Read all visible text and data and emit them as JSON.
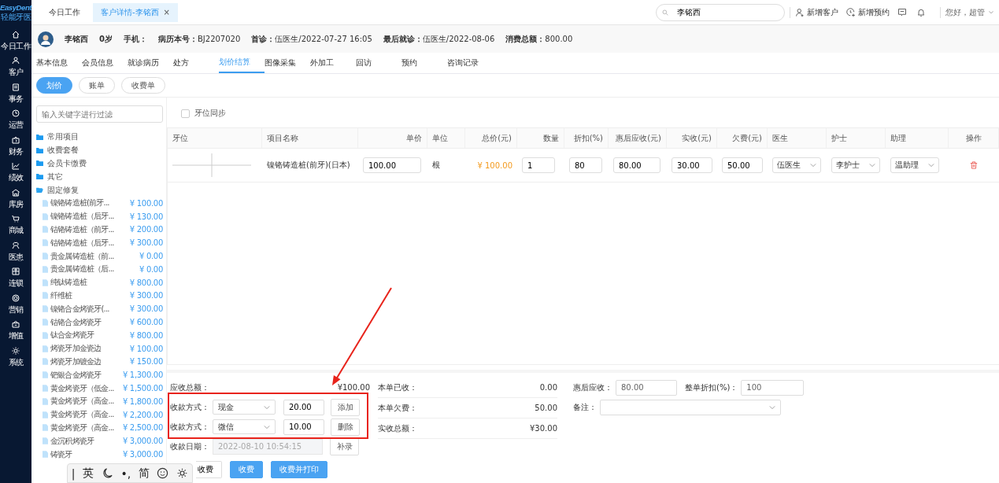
{
  "brand": {
    "name": "EasyDent",
    "subtitle": "轻能牙医"
  },
  "nav": [
    {
      "label": "今日工作"
    },
    {
      "label": "客户"
    },
    {
      "label": "事务"
    },
    {
      "label": "运营"
    },
    {
      "label": "财务"
    },
    {
      "label": "绩效"
    },
    {
      "label": "库房"
    },
    {
      "label": "商城"
    },
    {
      "label": "医患"
    },
    {
      "label": "连锁"
    },
    {
      "label": "营销"
    },
    {
      "label": "增值"
    },
    {
      "label": "系统"
    }
  ],
  "top_tabs": [
    {
      "label": "今日工作",
      "selected": false
    },
    {
      "label": "客户详情-李铭西",
      "selected": true,
      "close": "×"
    }
  ],
  "search": {
    "value": "李铭西"
  },
  "header_actions": [
    {
      "label": "新增客户",
      "kind": "customer"
    },
    {
      "label": "新增预约",
      "kind": "appointment"
    }
  ],
  "greeting": "您好，超管",
  "patient": {
    "name": "李铭西",
    "age": "0岁",
    "fields": [
      {
        "label": "手机："
      },
      {
        "label": "病历本号：",
        "value": "BJ2207020"
      },
      {
        "label": "首诊：",
        "value": "伍医生/2022-07-27 16:05"
      },
      {
        "label": "最后就诊：",
        "value": "伍医生/2022-08-06"
      },
      {
        "label": "消费总额：",
        "value": "800.00"
      }
    ]
  },
  "tabs": [
    {
      "label": "基本信息",
      "selected": false
    },
    {
      "label": "会员信息",
      "selected": false
    },
    {
      "label": "就诊病历",
      "selected": false
    },
    {
      "label": "处方",
      "selected": false
    },
    {
      "label": "划价结算",
      "selected": true
    },
    {
      "label": "图像采集",
      "selected": false
    },
    {
      "label": "外加工",
      "selected": false
    },
    {
      "label": "回访",
      "selected": false
    },
    {
      "label": "预约",
      "selected": false
    },
    {
      "label": "咨询记录",
      "selected": false
    }
  ],
  "sub_tabs": [
    {
      "label": "划价",
      "selected": true
    },
    {
      "label": "账单",
      "selected": false
    },
    {
      "label": "收费单",
      "selected": false
    }
  ],
  "filter": {
    "placeholder": "输入关键字进行过滤"
  },
  "tree": [
    {
      "label": "常用项目",
      "expanded": false
    },
    {
      "label": "收费套餐",
      "expanded": false
    },
    {
      "label": "会员卡缴费",
      "expanded": false
    },
    {
      "label": "其它",
      "expanded": false
    },
    {
      "label": "固定修复",
      "expanded": true,
      "children": [
        {
          "label": "镍铬铸造桩(前牙...",
          "price": "¥ 100.00"
        },
        {
          "label": "镍铬铸造桩（后牙...",
          "price": "¥ 130.00"
        },
        {
          "label": "钴铬铸造桩（前牙...",
          "price": "¥ 200.00"
        },
        {
          "label": "钴铬铸造桩（后牙...",
          "price": "¥ 300.00"
        },
        {
          "label": "贵金属铸造桩（前...",
          "price": "¥ 0.00"
        },
        {
          "label": "贵金属铸造桩（后...",
          "price": "¥ 0.00"
        },
        {
          "label": "纯钛铸造桩",
          "price": "¥ 800.00"
        },
        {
          "label": "纤维桩",
          "price": "¥ 300.00"
        },
        {
          "label": "镍铬合金烤瓷牙(...",
          "price": "¥ 300.00"
        },
        {
          "label": "钴铬合金烤瓷牙",
          "price": "¥ 600.00"
        },
        {
          "label": "钛合金烤瓷牙",
          "price": "¥ 800.00"
        },
        {
          "label": "烤瓷牙加金瓷边",
          "price": "¥ 100.00"
        },
        {
          "label": "烤瓷牙加镀金边",
          "price": "¥ 150.00"
        },
        {
          "label": "钯银合金烤瓷牙",
          "price": "¥ 1,300.00"
        },
        {
          "label": "黄金烤瓷牙（低金...",
          "price": "¥ 1,500.00"
        },
        {
          "label": "黄金烤瓷牙（高金...",
          "price": "¥ 1,800.00"
        },
        {
          "label": "黄金烤瓷牙（高金...",
          "price": "¥ 2,200.00"
        },
        {
          "label": "黄金烤瓷牙（高金...",
          "price": "¥ 2,500.00"
        },
        {
          "label": "金沉积烤瓷牙",
          "price": "¥ 3,000.00"
        },
        {
          "label": "铸瓷牙",
          "price": "¥ 3,000.00"
        }
      ]
    }
  ],
  "tooth_sync": {
    "label": "牙位同步",
    "checked": false
  },
  "table": {
    "columns": [
      "牙位",
      "项目名称",
      "单价",
      "单位",
      "总价(元)",
      "数量",
      "折扣(%)",
      "惠后应收(元)",
      "实收(元)",
      "欠费(元)",
      "医生",
      "护士",
      "助理",
      "操作"
    ],
    "rows": [
      {
        "name": "镍铬铸造桩(前牙)(日本)",
        "unit_price": "100.00",
        "unit": "根",
        "total": "¥ 100.00",
        "quantity": "1",
        "discount": "80",
        "after_discount": "80.00",
        "paid": "30.00",
        "owed": "50.00",
        "doctor": "伍医生",
        "nurse": "李护士",
        "assistant": "温助理"
      }
    ]
  },
  "summary": {
    "receivable_label": "应收总额：",
    "receivable": "¥100.00",
    "payments": [
      {
        "label": "收款方式：",
        "method": "现金",
        "amount": "20.00",
        "action": "添加"
      },
      {
        "label": "收款方式：",
        "method": "微信",
        "amount": "10.00",
        "action": "删除"
      }
    ],
    "date_label": "收款日期：",
    "date": "2022-08-10 10:54:15",
    "supplement": "补录",
    "totals": [
      {
        "label": "本单已收：",
        "value": "0.00"
      },
      {
        "label": "本单欠费：",
        "value": "50.00"
      },
      {
        "label": "实收总额：",
        "value": "¥30.00"
      }
    ],
    "after_label": "惠后应收：",
    "after": "80.00",
    "discount_label": "整单折扣(%)：",
    "discount": "100",
    "note_label": "备注："
  },
  "actions": [
    {
      "label": "收费",
      "kind": "outline"
    },
    {
      "label": "收费",
      "kind": "primary"
    },
    {
      "label": "收费并打印",
      "kind": "primary"
    }
  ],
  "ime_toolbar": [
    "|",
    "英",
    "•,",
    "简"
  ]
}
